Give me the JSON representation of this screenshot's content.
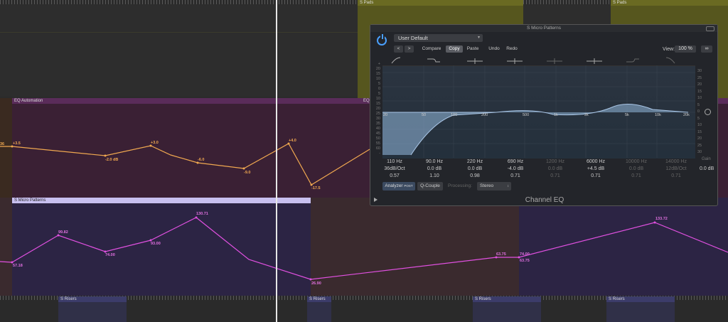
{
  "regions": {
    "pads_1": "S Pads",
    "pads_2": "S Pads",
    "eq_automation": "EQ Automation",
    "eq_automation_2": "EQ A",
    "micro_patterns": "S Micro Patterns",
    "risers": [
      "S Risers",
      "S Risers",
      "S Risers",
      "S Risers"
    ]
  },
  "eq_points": [
    {
      "label": "36",
      "value": 36
    },
    {
      "label": "+3.5",
      "value": 3.5
    },
    {
      "label": "-2.0 dB",
      "value": -2.0
    },
    {
      "label": "+3.0",
      "value": 3.0
    },
    {
      "label": "-6.0",
      "value": -6.0
    },
    {
      "label": "-9.0",
      "value": -9.0
    },
    {
      "label": "+4.0",
      "value": 4.0
    },
    {
      "label": "-17.5",
      "value": -17.5
    }
  ],
  "micro_points": [
    {
      "label": "57.18",
      "value": 57.18
    },
    {
      "label": "99.82",
      "value": 99.82
    },
    {
      "label": "74.00",
      "value": 74.0
    },
    {
      "label": "93.00",
      "value": 93.0
    },
    {
      "label": "130.71",
      "value": 130.71
    },
    {
      "label": "26.90",
      "value": 26.9
    },
    {
      "label": "63.75",
      "value": 63.75
    },
    {
      "label": "74.00",
      "value": 74.0
    },
    {
      "label": "63.75",
      "value": 63.75
    },
    {
      "label": "133.72",
      "value": 133.72
    }
  ],
  "plugin": {
    "title": "S Micro Patterns",
    "preset": "User Default",
    "prev": "<",
    "next": ">",
    "compare": "Compare",
    "copy": "Copy",
    "paste": "Paste",
    "undo": "Undo",
    "redo": "Redo",
    "view_label": "View:",
    "view_value": "100 %",
    "analyzer": "Analyzer",
    "analyzer_sub": "POST",
    "qcouple": "Q-Couple",
    "processing_label": "Processing:",
    "processing_value": "Stereo",
    "name": "Channel EQ",
    "gain_label": "Gain",
    "gain_value": "0.0 dB",
    "freq_scale": [
      "20",
      "50",
      "100",
      "200",
      "500",
      "1k",
      "2k",
      "5k",
      "10k",
      "20k"
    ],
    "db_scale_left": [
      "+",
      "20",
      "15",
      "10",
      "5",
      "0",
      "5",
      "10",
      "15",
      "20",
      "25",
      "30",
      "35",
      "40",
      "45",
      "50",
      "55",
      "60",
      "-"
    ],
    "db_scale_right": [
      "30",
      "25",
      "20",
      "15",
      "10",
      "5",
      "0",
      "5",
      "10",
      "15",
      "20",
      "25",
      "30"
    ],
    "bands": [
      {
        "freq": "110 Hz",
        "gain": "36dB/Oct",
        "q": "0.57",
        "active": true
      },
      {
        "freq": "90.0 Hz",
        "gain": "0.0 dB",
        "q": "1.10",
        "active": true
      },
      {
        "freq": "220 Hz",
        "gain": "0.0 dB",
        "q": "0.98",
        "active": true
      },
      {
        "freq": "690 Hz",
        "gain": "-4.0 dB",
        "q": "0.71",
        "active": true
      },
      {
        "freq": "1200 Hz",
        "gain": "0.0 dB",
        "q": "0.71",
        "active": false
      },
      {
        "freq": "6000 Hz",
        "gain": "+4.5 dB",
        "q": "0.71",
        "active": true
      },
      {
        "freq": "10000 Hz",
        "gain": "0.0 dB",
        "q": "0.71",
        "active": false
      },
      {
        "freq": "14000 Hz",
        "gain": "12dB/Oct",
        "q": "0.71",
        "active": false
      }
    ]
  },
  "colors": {
    "pads": "#56561e",
    "eq_region": "#3a2034",
    "eq_line": "#f0a850",
    "micro_region": "#2c2444",
    "micro_line": "#e050e0",
    "accent": "#4aa0ff"
  }
}
